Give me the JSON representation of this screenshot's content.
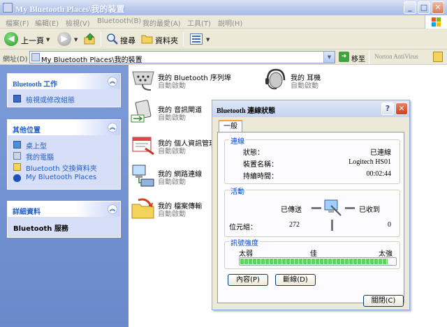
{
  "window": {
    "title": "My Bluetooth Places\\我的裝置"
  },
  "menu": [
    "檔案(F)",
    "編輯(E)",
    "檢視(V)",
    "Bluetooth(B)",
    "我的最愛(A)",
    "工具(T)",
    "說明(H)"
  ],
  "toolbar": {
    "back": "上一頁",
    "search": "搜尋",
    "folders": "資料夾"
  },
  "address": {
    "label": "網址(D)",
    "value": "My Bluetooth Places\\我的裝置",
    "go": "移至",
    "plugin": "Norton AntiVirus"
  },
  "tasks": {
    "bluetooth_tasks": {
      "title": "Bluetooth 工作",
      "items": [
        "檢視或修改組態"
      ]
    },
    "other_places": {
      "title": "其他位置",
      "items": [
        "桌上型",
        "我的電腦",
        "Bluetooth 交換資料夾",
        "My Bluetooth Places"
      ]
    },
    "details": {
      "title": "詳細資料",
      "body": "Bluetooth 服務"
    }
  },
  "items": [
    {
      "name": "我的 Bluetooth 序列埠",
      "status": "自動啟動"
    },
    {
      "name": "我的 耳機",
      "status": "自動啟動"
    },
    {
      "name": "我的 音訊閘道",
      "status": "自動啟動"
    },
    {
      "name": "我的 個人資訊管理",
      "status": "自動啟動"
    },
    {
      "name": "我的 網路連線",
      "status": "自動啟動"
    },
    {
      "name": "我的 檔案傳輸",
      "status": "自動啟動"
    }
  ],
  "dialog": {
    "title": "Bluetooth 連線狀態",
    "tab": "一般",
    "connection": {
      "label": "連線",
      "state_label": "狀態：",
      "state": "已連線",
      "device_label": "裝置名稱：",
      "device": "Logitech HS01",
      "duration_label": "持續時間：",
      "duration": "00:02:44"
    },
    "activity": {
      "label": "活動",
      "sent_label": "已傳送",
      "received_label": "已收到",
      "bytes_label": "位元組：",
      "sent": "272",
      "received": "0"
    },
    "signal": {
      "label": "訊號強度",
      "weak": "太弱",
      "good": "佳",
      "strong": "太強",
      "level": 0.95
    },
    "buttons": {
      "properties": "內容(P)",
      "disconnect": "斷線(D)",
      "close": "關閉(C)"
    }
  },
  "colors": {
    "taskpane": "#6a89cc",
    "link": "#215dc6",
    "progress": "#5fd35f"
  }
}
